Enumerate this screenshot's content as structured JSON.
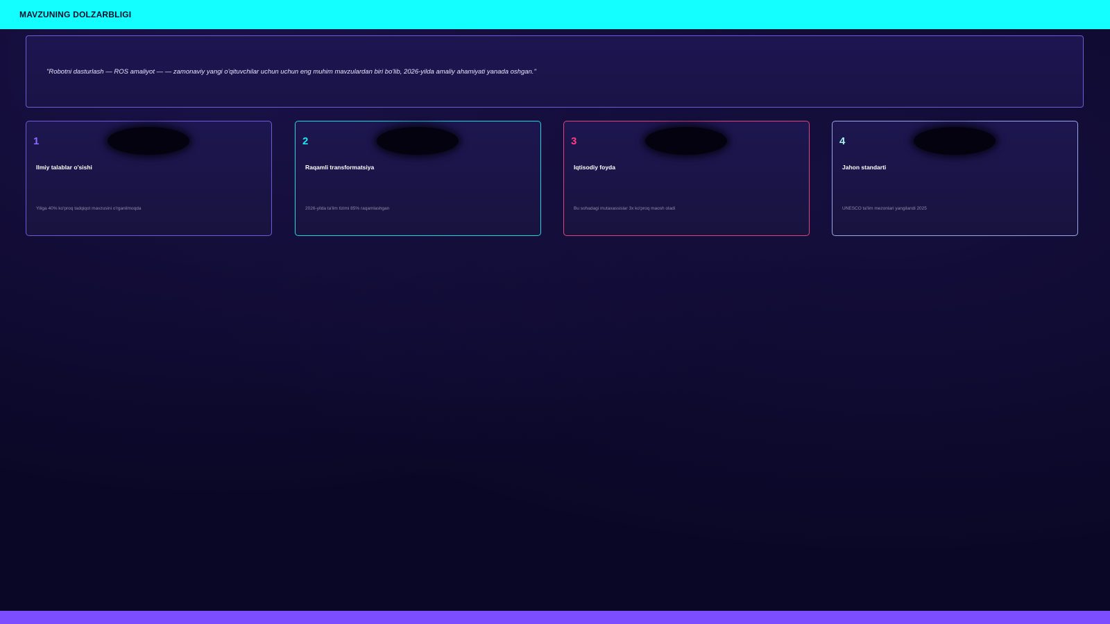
{
  "header": {
    "title": "MAVZUNING DOLZARBLIGI"
  },
  "quote": {
    "text": "\"Robotni dasturlash — ROS amaliyot — — zamonaviy yangi o'qituvchilar uchun uchun eng muhim mavzulardan biri bo'lib, 2026-yilda amaliy ahamiyati yanada oshgan.\""
  },
  "cards": [
    {
      "number": "1",
      "title": "Ilmiy talablar o'sishi",
      "description": "Yiliga 40% ko'proq tadqiqot mavzusini o'rganilmoqda",
      "accent": "#8a6dff"
    },
    {
      "number": "2",
      "title": "Raqamli transformatsiya",
      "description": "2026-yilda ta'lim tizimi 85% raqamlashgan",
      "accent": "#22e6ee"
    },
    {
      "number": "3",
      "title": "Iqtisodiy foyda",
      "description": "Bu sohadagi mutaxassislar 3x ko'proq maosh oladi",
      "accent": "#ff3d86"
    },
    {
      "number": "4",
      "title": "Jahon standarti",
      "description": "UNESCO ta'lim mezonlari yangilandi 2025",
      "accent": "#a8f0e8"
    }
  ],
  "colors": {
    "header_bg": "#13ffff",
    "page_bg": "#0a0726",
    "footer_bar": "#7b4dff"
  }
}
